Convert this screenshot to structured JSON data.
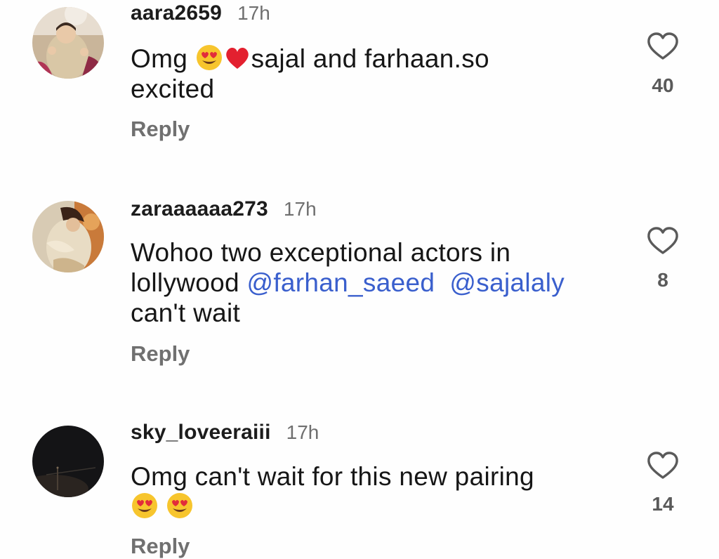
{
  "comments": [
    {
      "username": "aara2659",
      "time": "17h",
      "text_line1_a": "Omg ",
      "text_line1_b": "sajal and farhaan.so",
      "text_line2": "excited",
      "reply": "Reply",
      "likes": "40"
    },
    {
      "username": "zaraaaaaa273",
      "time": "17h",
      "text_line1": "Wohoo two exceptional actors in",
      "text_line2_a": "lollywood ",
      "mention1": "@farhan_saeed",
      "mention2": "@sajalaly",
      "text_line3": "can't wait",
      "reply": "Reply",
      "likes": "8"
    },
    {
      "username": "sky_loveeraiii",
      "time": "17h",
      "text_line1": "Omg can't wait for this new pairing",
      "reply": "Reply",
      "likes": "14"
    }
  ],
  "colors": {
    "mention": "#3a5fcd",
    "muted": "#707070",
    "text": "#161616"
  },
  "icons": {
    "like": "heart-outline-icon",
    "mention": "threads-at-icon",
    "emoji1": "heart-eyes-emoji",
    "emoji2": "red-heart-emoji"
  }
}
